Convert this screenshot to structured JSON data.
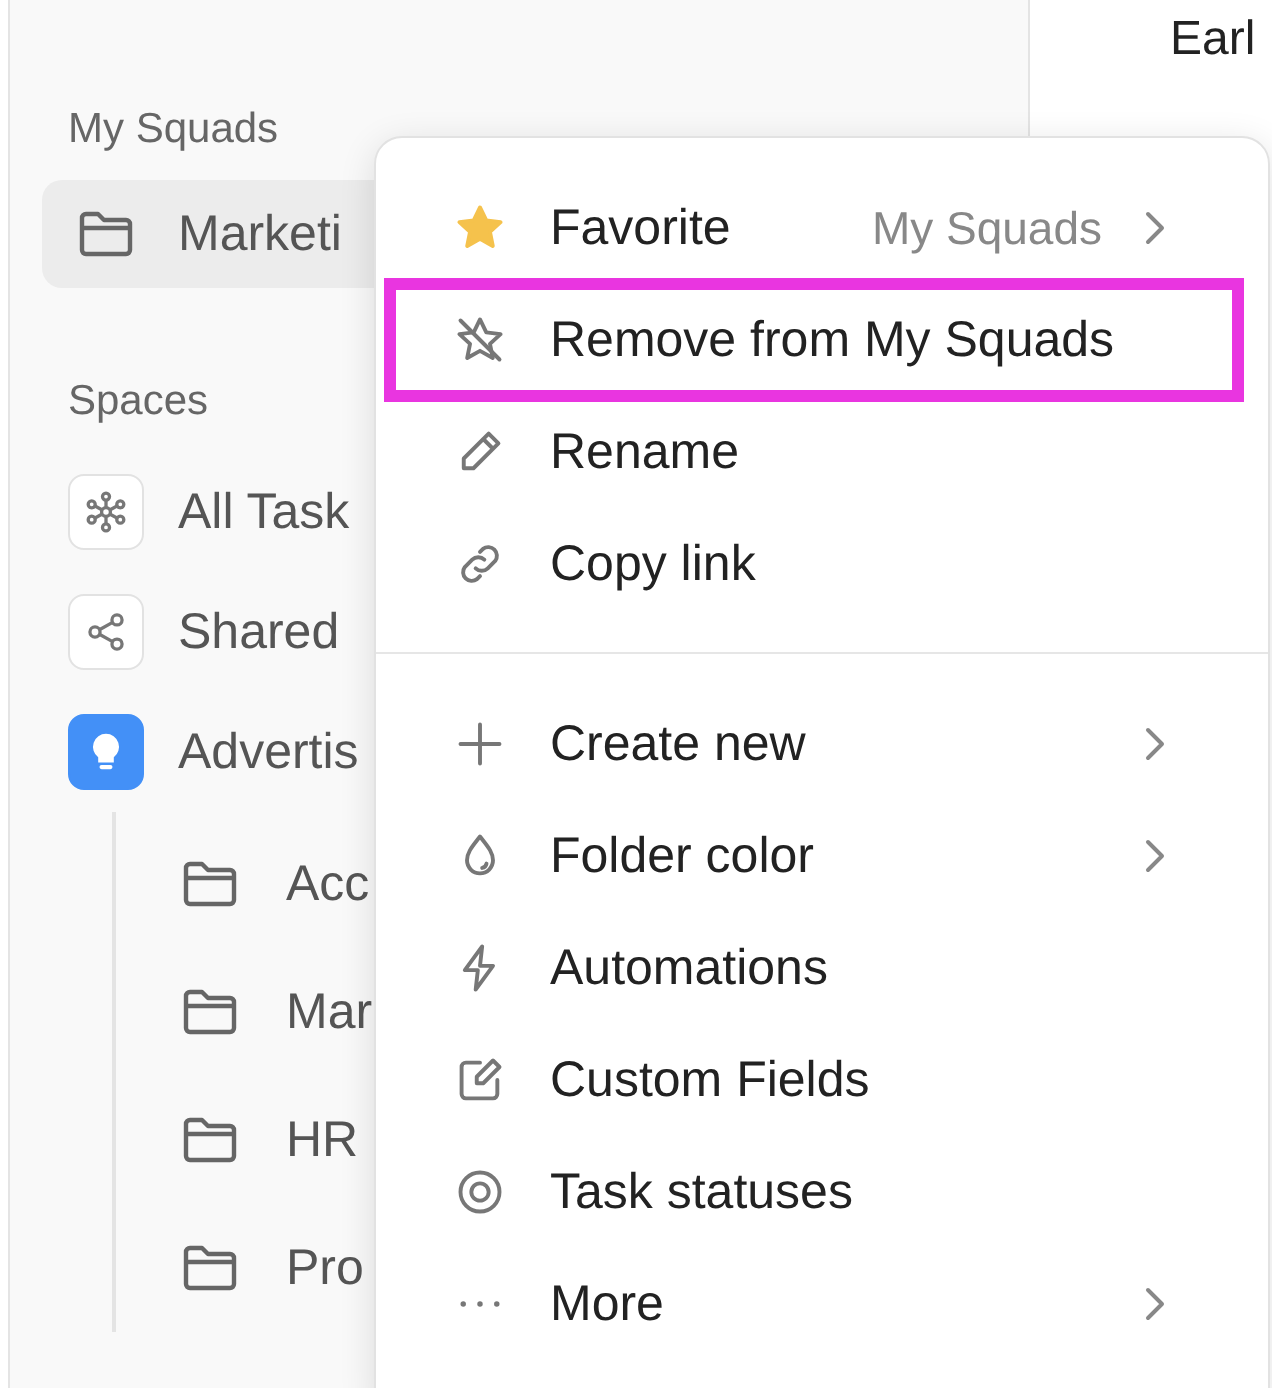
{
  "sidebar": {
    "sections": [
      {
        "title": "My Squads",
        "items": [
          {
            "label": "Marketi",
            "kind": "folder",
            "selected": true
          }
        ]
      },
      {
        "title": "Spaces",
        "items": [
          {
            "label": "All Task",
            "kind": "everything",
            "selected": false
          },
          {
            "label": "Shared",
            "kind": "shared",
            "selected": false
          },
          {
            "label": "Advertis",
            "kind": "space",
            "selected": false,
            "children": [
              {
                "label": "Acc",
                "kind": "folder",
                "selected": false
              },
              {
                "label": "Mar",
                "kind": "folder",
                "selected": false
              },
              {
                "label": "HR",
                "kind": "folder",
                "selected": false
              },
              {
                "label": "Pro",
                "kind": "folder",
                "selected": false
              }
            ]
          }
        ]
      }
    ]
  },
  "main": {
    "heading": "Earl"
  },
  "context_menu": {
    "groups": [
      [
        {
          "kind": "star",
          "label": "Favorite",
          "hint": "My Squads",
          "submenu": true,
          "highlighted": false
        },
        {
          "kind": "star-off",
          "label": "Remove from My Squads",
          "submenu": false,
          "highlighted": true
        },
        {
          "kind": "pencil",
          "label": "Rename",
          "submenu": false,
          "highlighted": false
        },
        {
          "kind": "link",
          "label": "Copy link",
          "submenu": false,
          "highlighted": false
        }
      ],
      [
        {
          "kind": "plus",
          "label": "Create new",
          "submenu": true,
          "highlighted": false
        },
        {
          "kind": "drop",
          "label": "Folder color",
          "submenu": true,
          "highlighted": false
        },
        {
          "kind": "bolt",
          "label": "Automations",
          "submenu": false,
          "highlighted": false
        },
        {
          "kind": "edit",
          "label": "Custom Fields",
          "submenu": false,
          "highlighted": false
        },
        {
          "kind": "target",
          "label": "Task statuses",
          "submenu": false,
          "highlighted": false
        },
        {
          "kind": "dots",
          "label": "More",
          "submenu": true,
          "highlighted": false
        }
      ]
    ]
  }
}
